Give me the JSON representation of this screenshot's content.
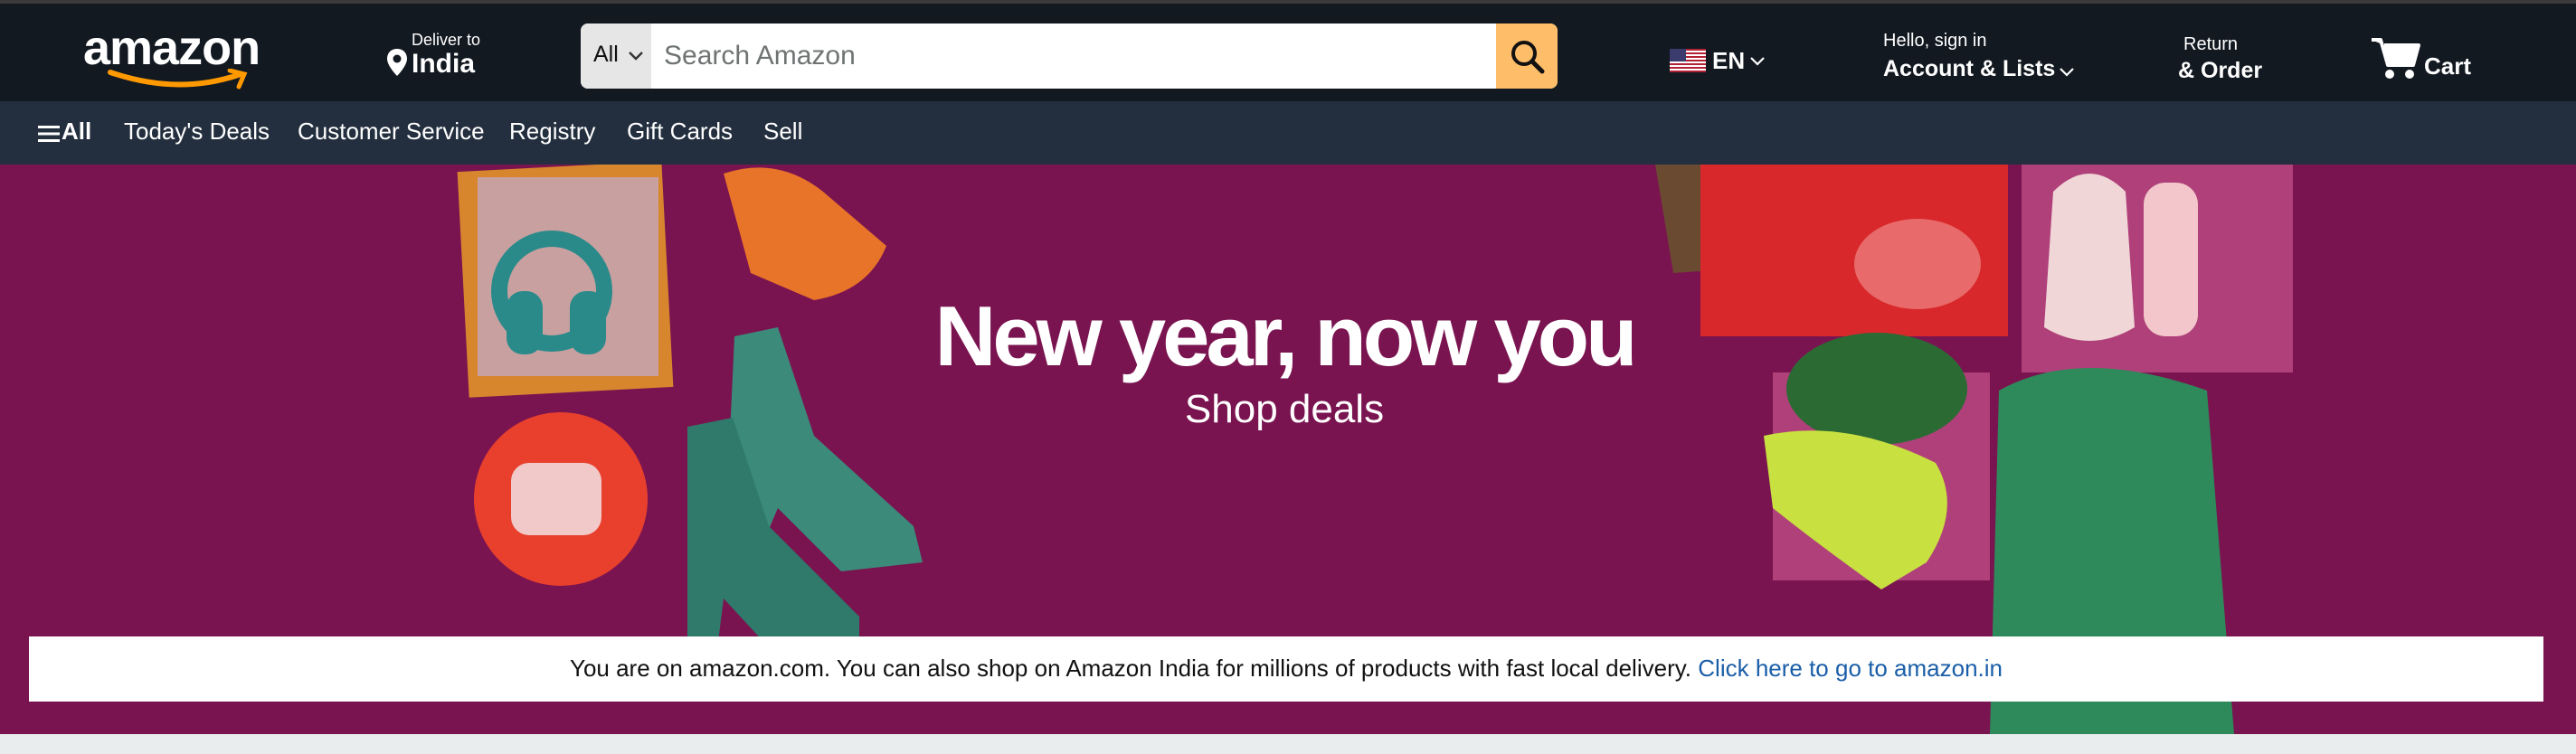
{
  "header": {
    "logo_text": "amazon",
    "deliver_to_label": "Deliver to",
    "deliver_to_location": "India",
    "search": {
      "category": "All",
      "placeholder": "Search Amazon",
      "value": ""
    },
    "language": "EN",
    "account_greeting": "Hello, sign in",
    "account_label": "Account & Lists",
    "returns_label": "Return",
    "orders_label": "& Order",
    "cart_label": "Cart"
  },
  "subnav": {
    "items": [
      {
        "label": "All"
      },
      {
        "label": "Today's Deals"
      },
      {
        "label": "Customer Service"
      },
      {
        "label": "Registry"
      },
      {
        "label": "Gift Cards"
      },
      {
        "label": "Sell"
      }
    ]
  },
  "hero": {
    "headline": "New year, now you",
    "subheadline": "Shop deals"
  },
  "notice": {
    "text": "You are on amazon.com. You can also shop on Amazon India for millions of products with fast local delivery.",
    "link_text": "Click here to go to amazon.in"
  },
  "colors": {
    "header_bg": "#131921",
    "subnav_bg": "#232f3e",
    "search_button": "#febd69",
    "hero_bg": "#7a1450",
    "link": "#1a5ea8"
  },
  "icons": [
    "amazon-smile-logo",
    "location-pin-icon",
    "chevron-down-icon",
    "search-icon",
    "us-flag-icon",
    "cart-icon",
    "hamburger-menu-icon"
  ]
}
